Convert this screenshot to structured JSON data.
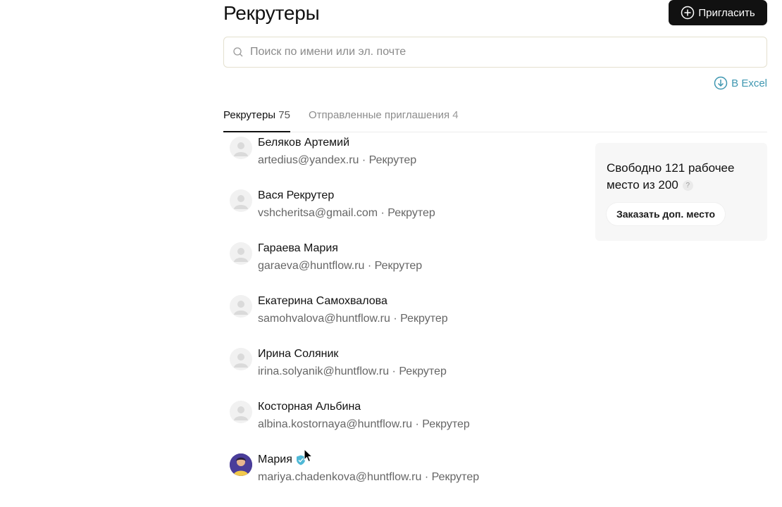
{
  "header": {
    "title": "Рекрутеры",
    "invite_label": "Пригласить"
  },
  "search": {
    "placeholder": "Поиск по имени или эл. почте",
    "value": ""
  },
  "export": {
    "label": "В Excel"
  },
  "tabs": [
    {
      "label": "Рекрутеры",
      "count": "75",
      "active": true
    },
    {
      "label": "Отправленные приглашения",
      "count": "4",
      "active": false
    }
  ],
  "recruiters": [
    {
      "name": "Беляков Артемий",
      "email": "artedius@yandex.ru",
      "role": "Рекрутер"
    },
    {
      "name": "Вася Рекрутер",
      "email": "vshcheritsa@gmail.com",
      "role": "Рекрутер"
    },
    {
      "name": "Гараева Мария",
      "email": "garaeva@huntflow.ru",
      "role": "Рекрутер"
    },
    {
      "name": "Екатерина Самохвалова",
      "email": "samohvalova@huntflow.ru",
      "role": "Рекрутер"
    },
    {
      "name": "Ирина Соляник",
      "email": "irina.solyanik@huntflow.ru",
      "role": "Рекрутер"
    },
    {
      "name": "Косторная Альбина",
      "email": "albina.kostornaya@huntflow.ru",
      "role": "Рекрутер"
    },
    {
      "name": "Мария",
      "email": "mariya.chadenkova@huntflow.ru",
      "role": "Рекрутер"
    }
  ],
  "meta_separator": " · ",
  "seats": {
    "text": "Свободно 121 рабочее место из 200",
    "help": "?",
    "order_label": "Заказать доп. место"
  },
  "colors": {
    "accent": "#3f97b1",
    "verified_badge": "#4fb8d6",
    "primary_button": "#111111"
  }
}
